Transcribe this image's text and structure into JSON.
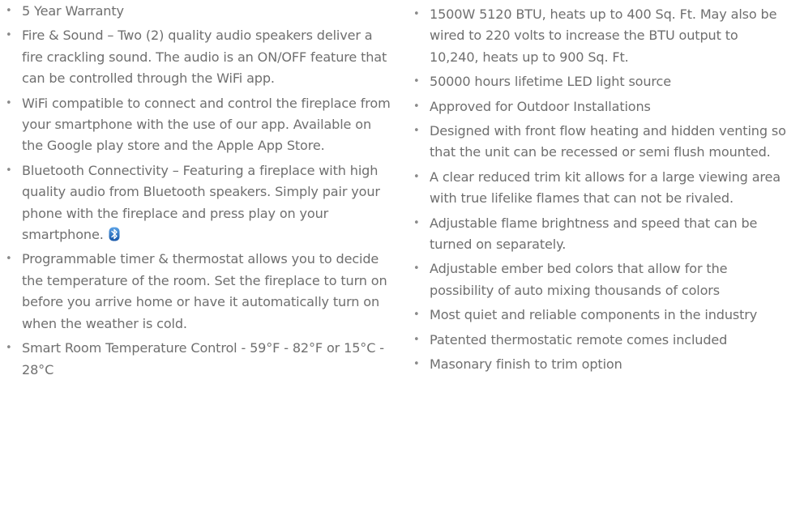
{
  "left_column": {
    "items": [
      "5 Year Warranty",
      "Fire & Sound – Two (2) quality audio speakers deliver a fire crackling sound. The audio is an ON/OFF feature that can be controlled through the WiFi app.",
      "WiFi compatible to connect and control the fireplace from your smartphone with the use of our app.  Available on the Google play store and the Apple App Store.",
      "Bluetooth Connectivity – Featuring a fireplace with high quality audio from Bluetooth speakers. Simply pair your phone with the fireplace and press play on your smartphone.",
      "Programmable timer & thermostat allows you to decide the temperature of the room.  Set the fireplace to turn on before you arrive home or have it automatically turn on when the weather is cold.",
      "Smart Room Temperature Control - 59°F - 82°F or 15°C - 28°C"
    ]
  },
  "right_column": {
    "items": [
      "1500W  5120 BTU, heats up to 400 Sq. Ft. May also be wired to 220 volts to increase the BTU output to 10,240, heats up to 900 Sq. Ft.",
      "50000 hours lifetime LED light source",
      "Approved for Outdoor Installations",
      "Designed with front flow heating and hidden venting so that the unit can be recessed or semi flush mounted.",
      "A clear reduced trim kit allows for a large viewing area with true lifelike flames that can not be rivaled.",
      "Adjustable flame brightness and speed that can be turned on separately.",
      "Adjustable ember bed colors that allow for the possibility of auto mixing thousands of colors",
      "Most quiet and reliable components in the industry",
      "Patented thermostatic remote comes included",
      "Masonary finish to trim option"
    ]
  },
  "icons": {
    "bluetooth": "bluetooth-icon"
  },
  "colors": {
    "text": "#6f6f6f",
    "bluetooth_blue": "#1f6fc0"
  }
}
